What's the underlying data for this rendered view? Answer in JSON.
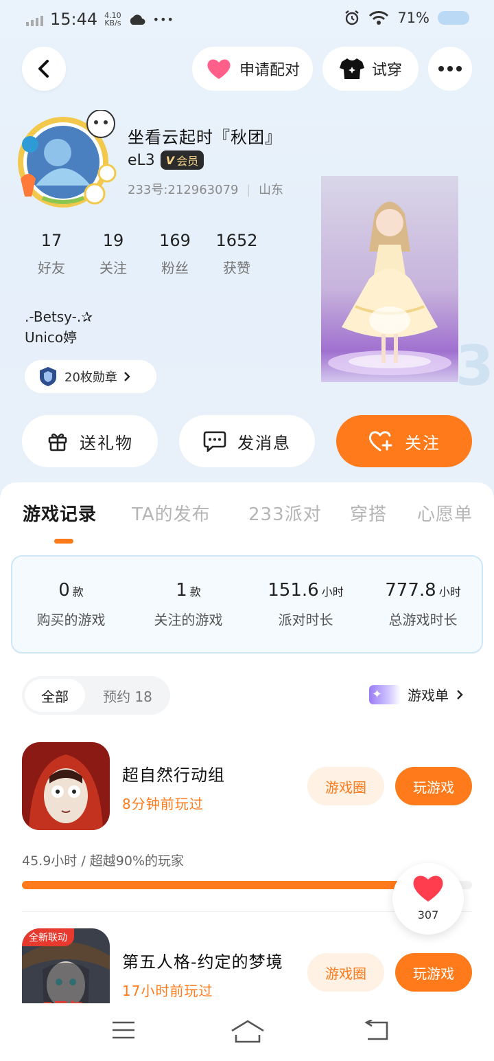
{
  "status_bar": {
    "time": "15:44",
    "speed_value": "4.10",
    "speed_unit": "KB/s",
    "dots": "•••",
    "battery": "71%"
  },
  "top_bar": {
    "match_label": "申请配对",
    "try_on_label": "试穿"
  },
  "profile": {
    "name": "坐看云起时『秋团』",
    "level": "eL3",
    "vip_label": "会员",
    "uid": "233号:212963079",
    "region": "山东",
    "stats": [
      {
        "value": "17",
        "label": "好友"
      },
      {
        "value": "19",
        "label": "关注"
      },
      {
        "value": "169",
        "label": "粉丝"
      },
      {
        "value": "1652",
        "label": "获赞"
      }
    ],
    "bio_line1": ".-Betsy-.✰",
    "bio_line2": "Unico婷",
    "badges_label": "20枚勋章"
  },
  "actions": {
    "gift": "送礼物",
    "message": "发消息",
    "follow": "关注"
  },
  "tabs": [
    "游戏记录",
    "TA的发布",
    "233派对",
    "穿搭",
    "心愿单"
  ],
  "summary": [
    {
      "value": "0",
      "unit": "款",
      "label": "购买的游戏"
    },
    {
      "value": "1",
      "unit": "款",
      "label": "关注的游戏"
    },
    {
      "value": "151.6",
      "unit": "小时",
      "label": "派对时长"
    },
    {
      "value": "777.8",
      "unit": "小时",
      "label": "总游戏时长"
    }
  ],
  "filter": {
    "all": "全部",
    "reserved": "预约 18"
  },
  "game_list_link": "游戏单",
  "games": [
    {
      "title": "超自然行动组",
      "last_played": "8分钟前玩过",
      "circle": "游戏圈",
      "play": "玩游戏"
    },
    {
      "title": "第五人格-约定的梦境",
      "last_played": "17小时前玩过",
      "circle": "游戏圈",
      "play": "玩游戏",
      "tag": "全新联动"
    }
  ],
  "game1_stats": {
    "playtime_text": "45.9小时 / 超越90%的玩家",
    "progress": 0.9
  },
  "like": {
    "count": "307"
  },
  "colors": {
    "accent": "#ff7a1a",
    "hero_bg": "#e6f0fa"
  }
}
